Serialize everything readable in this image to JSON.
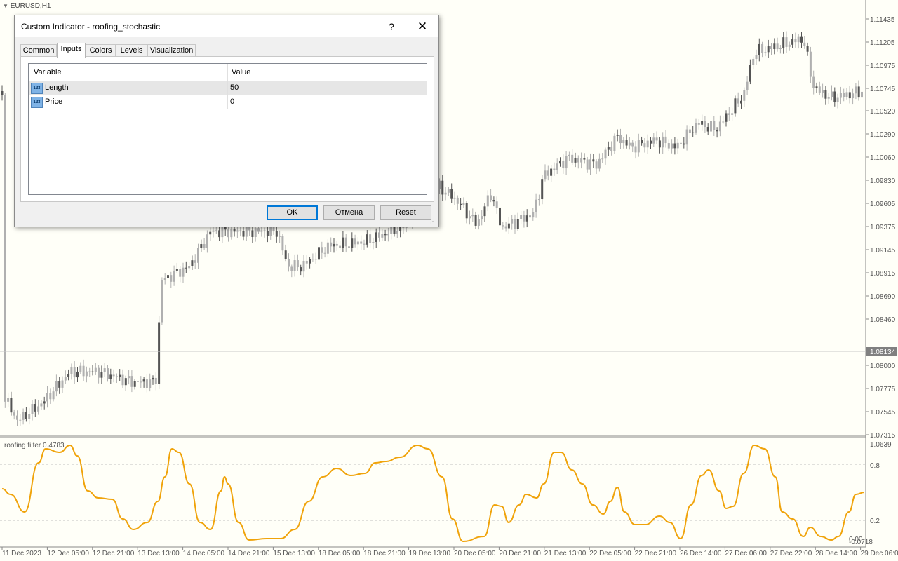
{
  "symbol_label": "EURUSD,H1",
  "indicator_label": "roofing filter 0.4783",
  "current_price": "1.08134",
  "price_axis": [
    "1.11435",
    "1.11205",
    "1.10975",
    "1.10745",
    "1.10520",
    "1.10290",
    "1.10060",
    "1.09830",
    "1.09605",
    "1.09375",
    "1.09145",
    "1.08915",
    "1.08690",
    "1.08460",
    "1.08000",
    "1.07775",
    "1.07545",
    "1.07315"
  ],
  "indicator_axis": [
    "1.0639",
    "0.8",
    "0.2",
    "0.00",
    "-0.0718"
  ],
  "time_axis": [
    "11 Dec 2023",
    "12 Dec 05:00",
    "12 Dec 21:00",
    "13 Dec 13:00",
    "14 Dec 05:00",
    "14 Dec 21:00",
    "15 Dec 13:00",
    "18 Dec 05:00",
    "18 Dec 21:00",
    "19 Dec 13:00",
    "20 Dec 05:00",
    "20 Dec 21:00",
    "21 Dec 13:00",
    "22 Dec 05:00",
    "22 Dec 21:00",
    "26 Dec 14:00",
    "27 Dec 06:00",
    "27 Dec 22:00",
    "28 Dec 14:00",
    "29 Dec 06:00"
  ],
  "colors": {
    "indicator_line": "#f0a30a",
    "candle": "#b0b0b0",
    "candle_dark": "#555555",
    "grid_dash": "#c0c0c0",
    "price_tag": "#808080"
  },
  "dialog": {
    "title": "Custom Indicator - roofing_stochastic",
    "help_icon": "?",
    "close_icon": "✕",
    "tabs": [
      "Common",
      "Inputs",
      "Colors",
      "Levels",
      "Visualization"
    ],
    "active_tab": "Inputs",
    "columns": {
      "variable": "Variable",
      "value": "Value"
    },
    "rows": [
      {
        "icon": "123",
        "name": "Length",
        "value": "50"
      },
      {
        "icon": "123",
        "name": "Price",
        "value": "0"
      }
    ],
    "buttons": {
      "ok": "OK",
      "cancel": "Отмена",
      "reset": "Reset"
    }
  }
}
